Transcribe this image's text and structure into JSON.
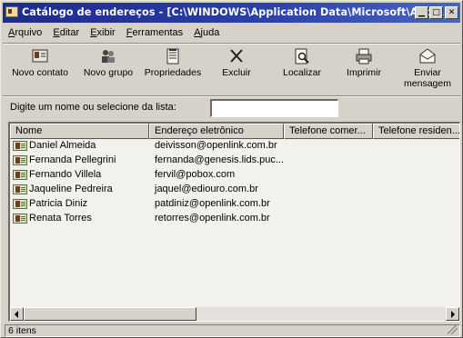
{
  "window": {
    "title": "Catálogo de endereços - [C:\\WINDOWS\\Application Data\\Microsoft\\Addr...",
    "min_glyph": "▁",
    "max_glyph": "□",
    "close_glyph": "✕"
  },
  "menu": [
    "Arquivo",
    "Editar",
    "Exibir",
    "Ferramentas",
    "Ajuda"
  ],
  "toolbar": [
    {
      "label1": "Novo contato",
      "label2": "",
      "icon": "new-contact-icon"
    },
    {
      "label1": "Novo grupo",
      "label2": "",
      "icon": "new-group-icon"
    },
    {
      "label1": "Propriedades",
      "label2": "",
      "icon": "properties-icon"
    },
    {
      "label1": "Excluir",
      "label2": "",
      "icon": "delete-icon"
    },
    {
      "label1": "Localizar",
      "label2": "",
      "icon": "find-icon"
    },
    {
      "label1": "Imprimir",
      "label2": "",
      "icon": "print-icon"
    },
    {
      "label1": "Enviar",
      "label2": "mensagem",
      "icon": "send-mail-icon"
    }
  ],
  "search": {
    "label": "Digite um nome ou selecione da lista:",
    "value": ""
  },
  "columns": [
    "Nome",
    "Endereço eletrônico",
    "Telefone comer...",
    "Telefone residen..."
  ],
  "contacts": [
    {
      "name": "Daniel Almeida",
      "email": "deivisson@openlink.com.br"
    },
    {
      "name": "Fernanda Pellegrini",
      "email": "fernanda@genesis.lids.puc..."
    },
    {
      "name": "Fernando Villela",
      "email": "fervil@pobox.com"
    },
    {
      "name": "Jaqueline Pedreira",
      "email": "jaquel@ediouro.com.br"
    },
    {
      "name": "Patricia Diniz",
      "email": "patdiniz@openlink.com.br"
    },
    {
      "name": "Renata Torres",
      "email": "retorres@openlink.com.br"
    }
  ],
  "status": "6 itens",
  "colors": {
    "title_bar": "#1e2b8c",
    "window_bg": "#d6d2ca"
  }
}
